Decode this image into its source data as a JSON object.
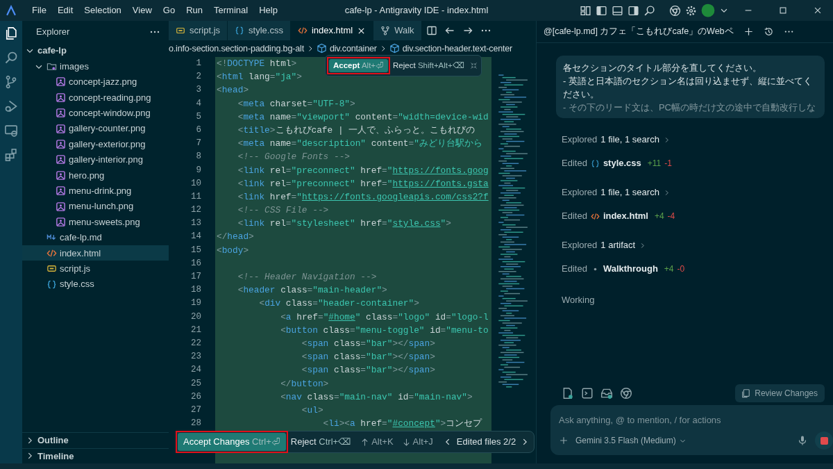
{
  "window": {
    "title": "cafe-lp - Antigravity IDE - index.html"
  },
  "menu": [
    "File",
    "Edit",
    "Selection",
    "View",
    "Go",
    "Run",
    "Terminal",
    "Help"
  ],
  "activity_bar": [
    {
      "kind": "files",
      "selected": true
    },
    {
      "kind": "search",
      "selected": false
    },
    {
      "kind": "branch",
      "selected": false
    },
    {
      "kind": "debug",
      "selected": false
    },
    {
      "kind": "remote",
      "selected": false
    },
    {
      "kind": "extensions",
      "selected": false
    }
  ],
  "sidebar": {
    "title": "Explorer",
    "tree": [
      {
        "label": "cafe-lp",
        "kind": "root",
        "expanded": true,
        "selected": false,
        "children": [
          {
            "label": "images",
            "kind": "folder",
            "expanded": true,
            "selected": false,
            "children": [
              {
                "label": "concept-jazz.png",
                "kind": "image",
                "selected": false
              },
              {
                "label": "concept-reading.png",
                "kind": "image",
                "selected": false
              },
              {
                "label": "concept-window.png",
                "kind": "image",
                "selected": false
              },
              {
                "label": "gallery-counter.png",
                "kind": "image",
                "selected": false
              },
              {
                "label": "gallery-exterior.png",
                "kind": "image",
                "selected": false
              },
              {
                "label": "gallery-interior.png",
                "kind": "image",
                "selected": false
              },
              {
                "label": "hero.png",
                "kind": "image",
                "selected": false
              },
              {
                "label": "menu-drink.png",
                "kind": "image",
                "selected": false
              },
              {
                "label": "menu-lunch.png",
                "kind": "image",
                "selected": false
              },
              {
                "label": "menu-sweets.png",
                "kind": "image",
                "selected": false
              }
            ]
          },
          {
            "label": "cafe-lp.md",
            "kind": "markdown",
            "selected": false
          },
          {
            "label": "index.html",
            "kind": "html",
            "selected": true
          },
          {
            "label": "script.js",
            "kind": "js",
            "selected": false
          },
          {
            "label": "style.css",
            "kind": "css",
            "selected": false
          }
        ]
      }
    ],
    "sections": [
      {
        "label": "Outline",
        "expanded": false
      },
      {
        "label": "Timeline",
        "expanded": false
      }
    ]
  },
  "tabs": [
    {
      "label": "script.js",
      "kind": "js",
      "selected": false
    },
    {
      "label": "style.css",
      "kind": "css",
      "selected": false
    },
    {
      "label": "index.html",
      "kind": "html",
      "selected": true
    },
    {
      "label": "Walk",
      "kind": "walkthrough",
      "selected": false
    }
  ],
  "breadcrumb": [
    {
      "label": "o.info-section.section-padding.bg-alt",
      "kind": "plain"
    },
    {
      "label": "div.container",
      "kind": "element"
    },
    {
      "label": "div.section-header.text-center",
      "kind": "element"
    }
  ],
  "code_lines": [
    {
      "number": "1",
      "tokens": [
        {
          "kind": "p",
          "text": "<!"
        },
        {
          "kind": "t",
          "text": "DOCTYPE"
        },
        {
          "kind": "a",
          "text": " html"
        },
        {
          "kind": "p",
          "text": ">"
        }
      ]
    },
    {
      "number": "2",
      "tokens": [
        {
          "kind": "p",
          "text": "<"
        },
        {
          "kind": "t",
          "text": "html"
        },
        {
          "kind": "a",
          "text": " lang"
        },
        {
          "kind": "p",
          "text": "="
        },
        {
          "kind": "s",
          "text": "\"ja\""
        },
        {
          "kind": "p",
          "text": ">"
        }
      ]
    },
    {
      "number": "3",
      "tokens": [
        {
          "kind": "p",
          "text": "<"
        },
        {
          "kind": "t",
          "text": "head"
        },
        {
          "kind": "p",
          "text": ">"
        }
      ]
    },
    {
      "number": "4",
      "tokens": [
        {
          "kind": "p",
          "text": "    <"
        },
        {
          "kind": "t",
          "text": "meta"
        },
        {
          "kind": "a",
          "text": " charset"
        },
        {
          "kind": "p",
          "text": "="
        },
        {
          "kind": "s",
          "text": "\"UTF-8\""
        },
        {
          "kind": "p",
          "text": ">"
        }
      ]
    },
    {
      "number": "5",
      "tokens": [
        {
          "kind": "p",
          "text": "    <"
        },
        {
          "kind": "t",
          "text": "meta"
        },
        {
          "kind": "a",
          "text": " name"
        },
        {
          "kind": "p",
          "text": "="
        },
        {
          "kind": "s",
          "text": "\"viewport\""
        },
        {
          "kind": "a",
          "text": " content"
        },
        {
          "kind": "p",
          "text": "="
        },
        {
          "kind": "s",
          "text": "\"width=device-wid"
        }
      ]
    },
    {
      "number": "6",
      "tokens": [
        {
          "kind": "p",
          "text": "    <"
        },
        {
          "kind": "t",
          "text": "title"
        },
        {
          "kind": "p",
          "text": ">"
        },
        {
          "kind": "x",
          "text": "こもれびcafe | 一人で、ふらっと。こもれびの"
        }
      ]
    },
    {
      "number": "7",
      "tokens": [
        {
          "kind": "p",
          "text": "    <"
        },
        {
          "kind": "t",
          "text": "meta"
        },
        {
          "kind": "a",
          "text": " name"
        },
        {
          "kind": "p",
          "text": "="
        },
        {
          "kind": "s",
          "text": "\"description\""
        },
        {
          "kind": "a",
          "text": " content"
        },
        {
          "kind": "p",
          "text": "="
        },
        {
          "kind": "s",
          "text": "\"みどり台駅から"
        }
      ]
    },
    {
      "number": "8",
      "tokens": [
        {
          "kind": "c",
          "text": "    <!-- Google Fonts -->"
        }
      ]
    },
    {
      "number": "9",
      "tokens": [
        {
          "kind": "p",
          "text": "    <"
        },
        {
          "kind": "t",
          "text": "link"
        },
        {
          "kind": "a",
          "text": " rel"
        },
        {
          "kind": "p",
          "text": "="
        },
        {
          "kind": "s",
          "text": "\"preconnect\""
        },
        {
          "kind": "a",
          "text": " href"
        },
        {
          "kind": "p",
          "text": "="
        },
        {
          "kind": "s",
          "text": "\""
        },
        {
          "kind": "u",
          "text": "https://fonts.goog"
        }
      ]
    },
    {
      "number": "10",
      "tokens": [
        {
          "kind": "p",
          "text": "    <"
        },
        {
          "kind": "t",
          "text": "link"
        },
        {
          "kind": "a",
          "text": " rel"
        },
        {
          "kind": "p",
          "text": "="
        },
        {
          "kind": "s",
          "text": "\"preconnect\""
        },
        {
          "kind": "a",
          "text": " href"
        },
        {
          "kind": "p",
          "text": "="
        },
        {
          "kind": "s",
          "text": "\""
        },
        {
          "kind": "u",
          "text": "https://fonts.gsta"
        }
      ]
    },
    {
      "number": "11",
      "tokens": [
        {
          "kind": "p",
          "text": "    <"
        },
        {
          "kind": "t",
          "text": "link"
        },
        {
          "kind": "a",
          "text": " href"
        },
        {
          "kind": "p",
          "text": "="
        },
        {
          "kind": "s",
          "text": "\""
        },
        {
          "kind": "u",
          "text": "https://fonts.googleapis.com/css2?f"
        }
      ]
    },
    {
      "number": "12",
      "tokens": [
        {
          "kind": "c",
          "text": "    <!-- CSS File -->"
        }
      ]
    },
    {
      "number": "13",
      "tokens": [
        {
          "kind": "p",
          "text": "    <"
        },
        {
          "kind": "t",
          "text": "link"
        },
        {
          "kind": "a",
          "text": " rel"
        },
        {
          "kind": "p",
          "text": "="
        },
        {
          "kind": "s",
          "text": "\"stylesheet\""
        },
        {
          "kind": "a",
          "text": " href"
        },
        {
          "kind": "p",
          "text": "="
        },
        {
          "kind": "s",
          "text": "\""
        },
        {
          "kind": "u",
          "text": "style.css"
        },
        {
          "kind": "s",
          "text": "\""
        },
        {
          "kind": "p",
          "text": ">"
        }
      ]
    },
    {
      "number": "14",
      "tokens": [
        {
          "kind": "p",
          "text": "</"
        },
        {
          "kind": "t",
          "text": "head"
        },
        {
          "kind": "p",
          "text": ">"
        }
      ]
    },
    {
      "number": "15",
      "tokens": [
        {
          "kind": "p",
          "text": "<"
        },
        {
          "kind": "t",
          "text": "body"
        },
        {
          "kind": "p",
          "text": ">"
        }
      ]
    },
    {
      "number": "16"
    },
    {
      "number": "17",
      "tokens": [
        {
          "kind": "c",
          "text": "    <!-- Header Navigation -->"
        }
      ]
    },
    {
      "number": "18",
      "tokens": [
        {
          "kind": "p",
          "text": "    <"
        },
        {
          "kind": "t",
          "text": "header"
        },
        {
          "kind": "a",
          "text": " class"
        },
        {
          "kind": "p",
          "text": "="
        },
        {
          "kind": "s",
          "text": "\"main-header\""
        },
        {
          "kind": "p",
          "text": ">"
        }
      ]
    },
    {
      "number": "19",
      "tokens": [
        {
          "kind": "p",
          "text": "        <"
        },
        {
          "kind": "t",
          "text": "div"
        },
        {
          "kind": "a",
          "text": " class"
        },
        {
          "kind": "p",
          "text": "="
        },
        {
          "kind": "s",
          "text": "\"header-container\""
        },
        {
          "kind": "p",
          "text": ">"
        }
      ]
    },
    {
      "number": "20",
      "tokens": [
        {
          "kind": "p",
          "text": "            <"
        },
        {
          "kind": "t",
          "text": "a"
        },
        {
          "kind": "a",
          "text": " href"
        },
        {
          "kind": "p",
          "text": "="
        },
        {
          "kind": "s",
          "text": "\""
        },
        {
          "kind": "u",
          "text": "#home"
        },
        {
          "kind": "s",
          "text": "\""
        },
        {
          "kind": "a",
          "text": " class"
        },
        {
          "kind": "p",
          "text": "="
        },
        {
          "kind": "s",
          "text": "\"logo\""
        },
        {
          "kind": "a",
          "text": " id"
        },
        {
          "kind": "p",
          "text": "="
        },
        {
          "kind": "s",
          "text": "\"logo-l"
        }
      ]
    },
    {
      "number": "21",
      "tokens": [
        {
          "kind": "p",
          "text": "            <"
        },
        {
          "kind": "t",
          "text": "button"
        },
        {
          "kind": "a",
          "text": " class"
        },
        {
          "kind": "p",
          "text": "="
        },
        {
          "kind": "s",
          "text": "\"menu-toggle\""
        },
        {
          "kind": "a",
          "text": " id"
        },
        {
          "kind": "p",
          "text": "="
        },
        {
          "kind": "s",
          "text": "\"menu-to"
        }
      ]
    },
    {
      "number": "22",
      "tokens": [
        {
          "kind": "p",
          "text": "                <"
        },
        {
          "kind": "t",
          "text": "span"
        },
        {
          "kind": "a",
          "text": " class"
        },
        {
          "kind": "p",
          "text": "="
        },
        {
          "kind": "s",
          "text": "\"bar\""
        },
        {
          "kind": "p",
          "text": "></"
        },
        {
          "kind": "t",
          "text": "span"
        },
        {
          "kind": "p",
          "text": ">"
        }
      ]
    },
    {
      "number": "23",
      "tokens": [
        {
          "kind": "p",
          "text": "                <"
        },
        {
          "kind": "t",
          "text": "span"
        },
        {
          "kind": "a",
          "text": " class"
        },
        {
          "kind": "p",
          "text": "="
        },
        {
          "kind": "s",
          "text": "\"bar\""
        },
        {
          "kind": "p",
          "text": "></"
        },
        {
          "kind": "t",
          "text": "span"
        },
        {
          "kind": "p",
          "text": ">"
        }
      ]
    },
    {
      "number": "24",
      "tokens": [
        {
          "kind": "p",
          "text": "                <"
        },
        {
          "kind": "t",
          "text": "span"
        },
        {
          "kind": "a",
          "text": " class"
        },
        {
          "kind": "p",
          "text": "="
        },
        {
          "kind": "s",
          "text": "\"bar\""
        },
        {
          "kind": "p",
          "text": "></"
        },
        {
          "kind": "t",
          "text": "span"
        },
        {
          "kind": "p",
          "text": ">"
        }
      ]
    },
    {
      "number": "25",
      "tokens": [
        {
          "kind": "p",
          "text": "            </"
        },
        {
          "kind": "t",
          "text": "button"
        },
        {
          "kind": "p",
          "text": ">"
        }
      ]
    },
    {
      "number": "26",
      "tokens": [
        {
          "kind": "p",
          "text": "            <"
        },
        {
          "kind": "t",
          "text": "nav"
        },
        {
          "kind": "a",
          "text": " class"
        },
        {
          "kind": "p",
          "text": "="
        },
        {
          "kind": "s",
          "text": "\"main-nav\""
        },
        {
          "kind": "a",
          "text": " id"
        },
        {
          "kind": "p",
          "text": "="
        },
        {
          "kind": "s",
          "text": "\"main-nav\""
        },
        {
          "kind": "p",
          "text": ">"
        }
      ]
    },
    {
      "number": "27",
      "tokens": [
        {
          "kind": "p",
          "text": "                <"
        },
        {
          "kind": "t",
          "text": "ul"
        },
        {
          "kind": "p",
          "text": ">"
        }
      ]
    },
    {
      "number": "28",
      "tokens": [
        {
          "kind": "p",
          "text": "                    <"
        },
        {
          "kind": "t",
          "text": "li"
        },
        {
          "kind": "p",
          "text": "><"
        },
        {
          "kind": "t",
          "text": "a"
        },
        {
          "kind": "a",
          "text": " href"
        },
        {
          "kind": "p",
          "text": "="
        },
        {
          "kind": "s",
          "text": "\""
        },
        {
          "kind": "u",
          "text": "#concept"
        },
        {
          "kind": "s",
          "text": "\""
        },
        {
          "kind": "p",
          "text": ">"
        },
        {
          "kind": "x",
          "text": "コンセプ"
        }
      ]
    }
  ],
  "inline_review": {
    "accept": "Accept",
    "accept_keys": "Alt+⏎",
    "accept_highlighted": true,
    "reject": "Reject",
    "reject_keys": "Shift+Alt+⌫"
  },
  "review_bar": {
    "accept": "Accept Changes",
    "accept_keys": "Ctrl+⏎",
    "accept_highlighted": true,
    "reject": "Reject",
    "reject_keys": "Ctrl+⌫",
    "prev_keys": "Alt+K",
    "next_keys": "Alt+J",
    "files": "Edited files 2/2"
  },
  "agent": {
    "title": "@[cafe-lp.md] カフェ「こもれびcafe」のWebペ",
    "message": [
      "各セクションのタイトル部分を直してください。",
      "- 英語と日本語のセクション名は回り込ませず、縦に並べてください。",
      "- その下のリード文は、PC幅の時だけ文の途中で自動改行しな"
    ],
    "steps": [
      {
        "kind": "explored",
        "label": "Explored",
        "detail": "1 file, 1 search"
      },
      {
        "kind": "edited",
        "label": "Edited",
        "file": {
          "kind": "css",
          "name": "style.css"
        },
        "added": "+11",
        "removed": "-1"
      },
      {
        "kind": "explored",
        "label": "Explored",
        "detail": "1 file, 1 search"
      },
      {
        "kind": "edited",
        "label": "Edited",
        "file": {
          "kind": "html",
          "name": "index.html"
        },
        "added": "+4",
        "removed": "-4"
      },
      {
        "kind": "explored",
        "label": "Explored",
        "detail": "1 artifact"
      },
      {
        "kind": "edited",
        "label": "Edited",
        "file": {
          "kind": "artifact",
          "name": "Walkthrough"
        },
        "added": "+4",
        "removed": "-0"
      }
    ],
    "status": "Working",
    "review_button": "Review Changes",
    "placeholder": "Ask anything, @ to mention, / for actions",
    "model": "Gemini 3.5 Flash (Medium)"
  }
}
